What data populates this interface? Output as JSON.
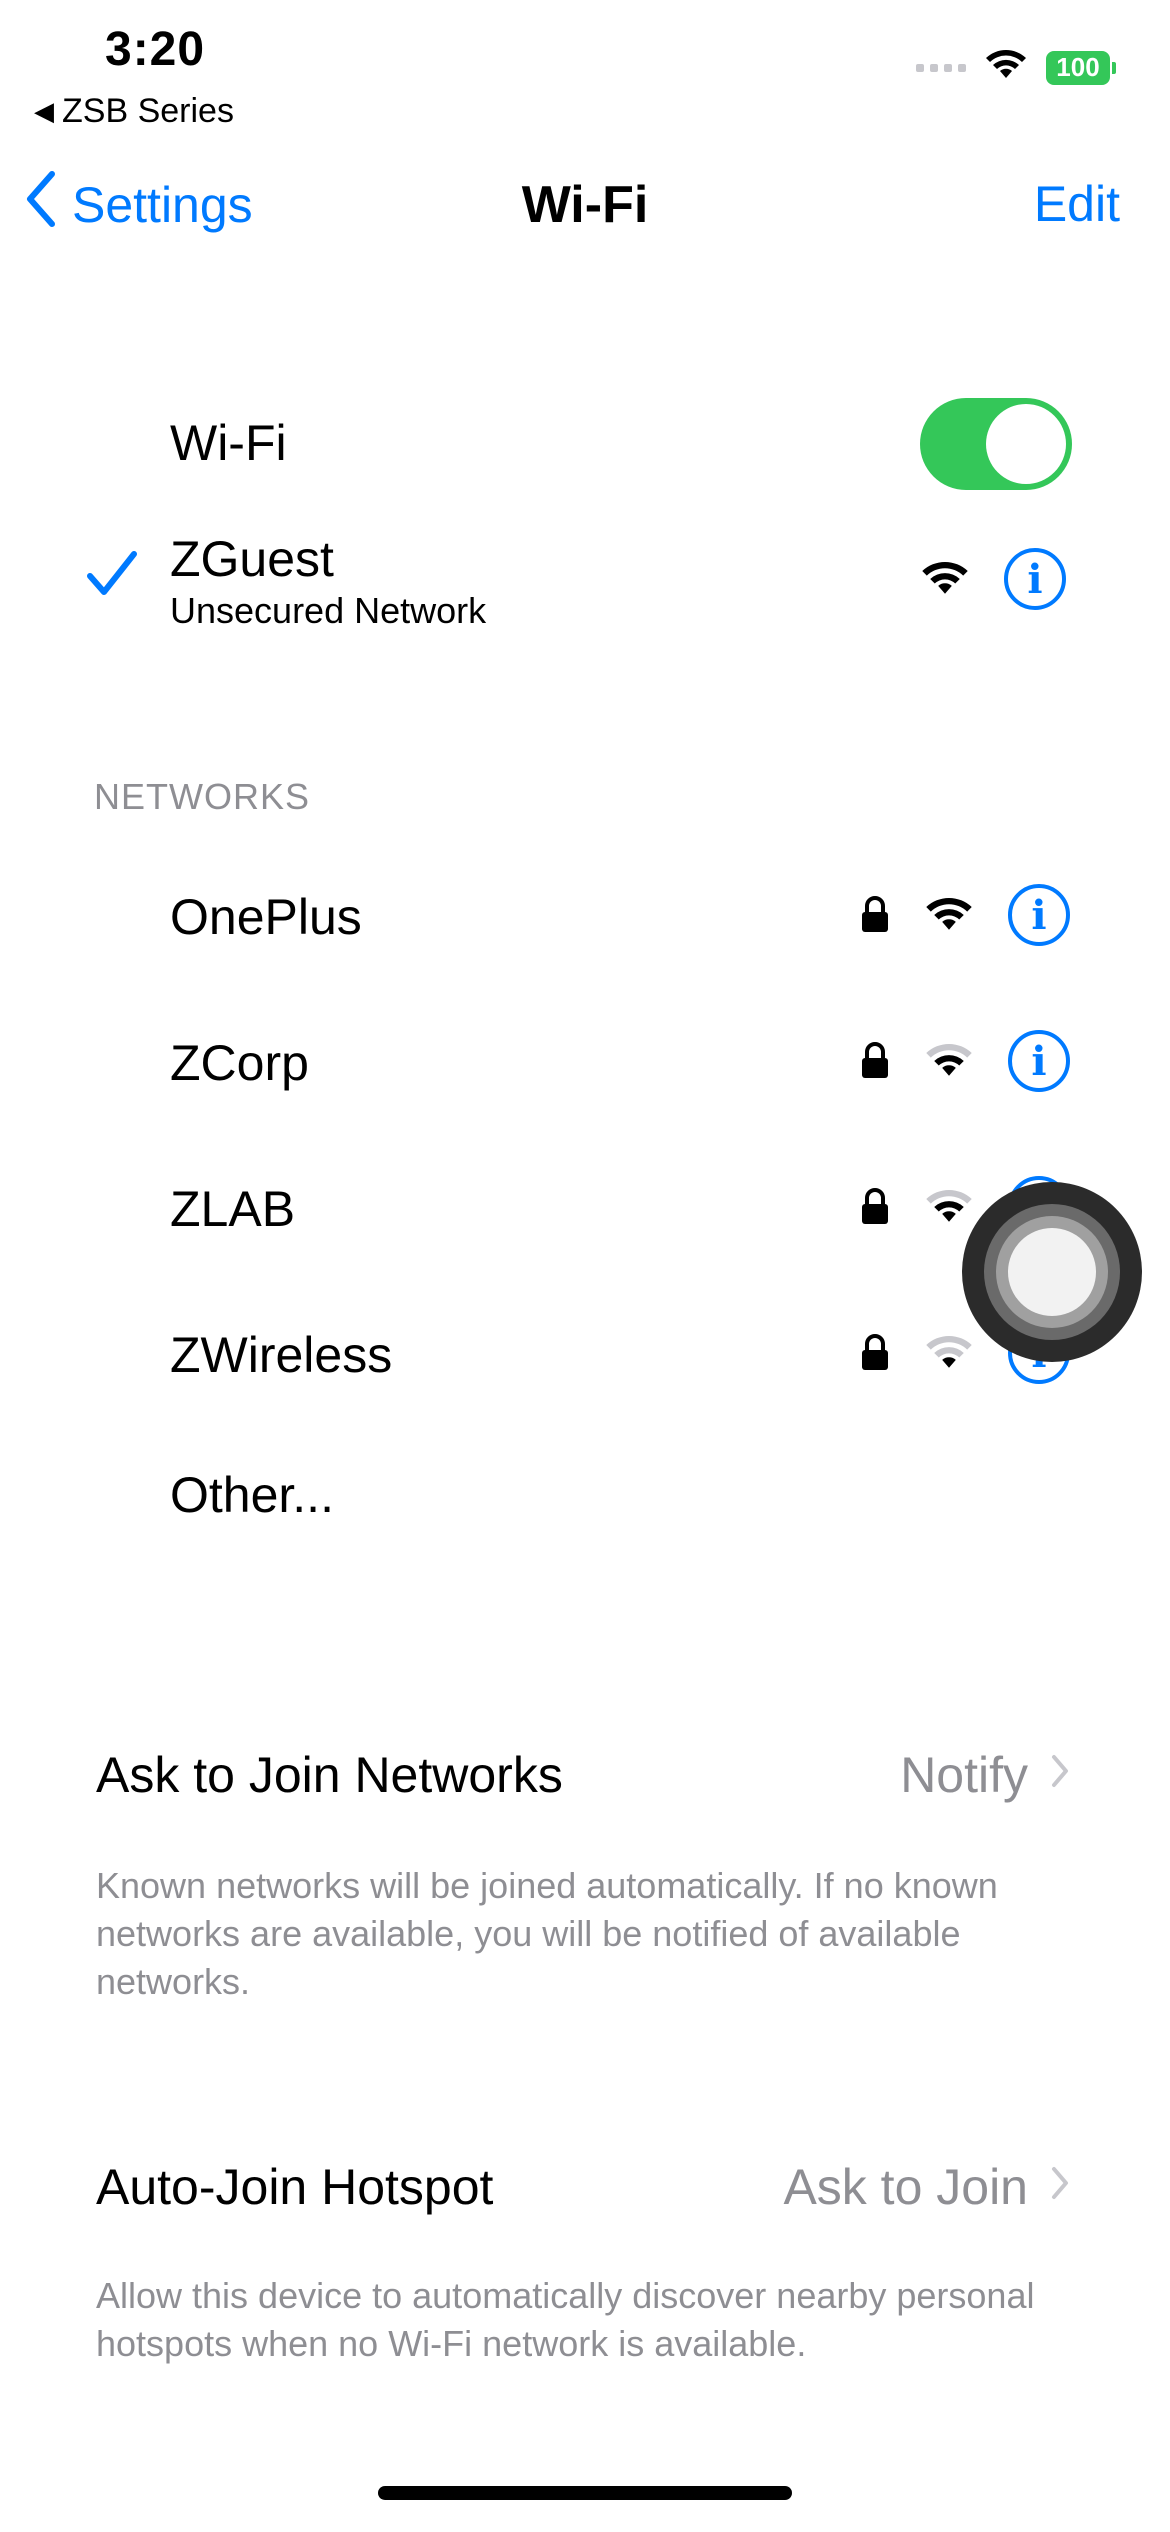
{
  "status_bar": {
    "time": "3:20",
    "back_app": "ZSB Series",
    "battery": "100"
  },
  "nav": {
    "back_label": "Settings",
    "title": "Wi-Fi",
    "edit_label": "Edit"
  },
  "wifi_toggle": {
    "label": "Wi-Fi",
    "state": "on"
  },
  "connected_network": {
    "name": "ZGuest",
    "subtitle": "Unsecured Network"
  },
  "networks_section": {
    "header": "NETWORKS",
    "items": [
      {
        "name": "OnePlus",
        "secured": true
      },
      {
        "name": "ZCorp",
        "secured": true
      },
      {
        "name": "ZLAB",
        "secured": true
      },
      {
        "name": "ZWireless",
        "secured": true
      }
    ],
    "other_label": "Other..."
  },
  "ask_to_join": {
    "label": "Ask to Join Networks",
    "value": "Notify",
    "footnote": "Known networks will be joined automatically. If no known networks are available, you will be notified of available networks."
  },
  "auto_join_hotspot": {
    "label": "Auto-Join Hotspot",
    "value": "Ask to Join",
    "footnote": "Allow this device to automatically discover nearby personal hotspots when no Wi-Fi network is available."
  },
  "colors": {
    "accent": "#007aff",
    "toggle_on": "#34c759",
    "secondary_text": "#8e8e93"
  }
}
